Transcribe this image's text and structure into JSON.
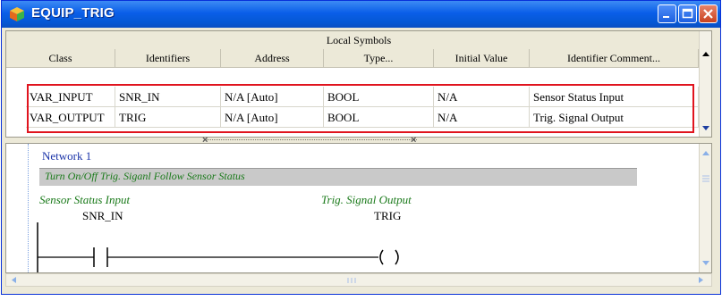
{
  "window": {
    "title": "EQUIP_TRIG"
  },
  "symbols": {
    "group_header": "Local Symbols",
    "columns": [
      "Class",
      "Identifiers",
      "Address",
      "Type...",
      "Initial Value",
      "Identifier Comment..."
    ],
    "rows": [
      [
        "VAR_INPUT",
        "SNR_IN",
        "N/A [Auto]",
        "BOOL",
        "N/A",
        "Sensor Status Input"
      ],
      [
        "VAR_OUTPUT",
        "TRIG",
        "N/A [Auto]",
        "BOOL",
        "N/A",
        "Trig. Signal Output"
      ]
    ]
  },
  "ladder": {
    "network_title": "Network 1",
    "network_comment": "Turn On/Off Trig. Siganl Follow Sensor Status",
    "contact": {
      "comment": "Sensor Status Input",
      "identifier": "SNR_IN"
    },
    "coil": {
      "comment": "Trig. Signal Output",
      "identifier": "TRIG"
    }
  },
  "colors": {
    "highlight": "#e0141e",
    "comment_text": "#1a7a1a",
    "network_title": "#1a33a8"
  },
  "icons": [
    "app-icon",
    "minimize-icon",
    "maximize-icon",
    "close-icon",
    "scroll-up-icon",
    "scroll-down-icon",
    "scroll-left-icon",
    "scroll-right-icon"
  ]
}
